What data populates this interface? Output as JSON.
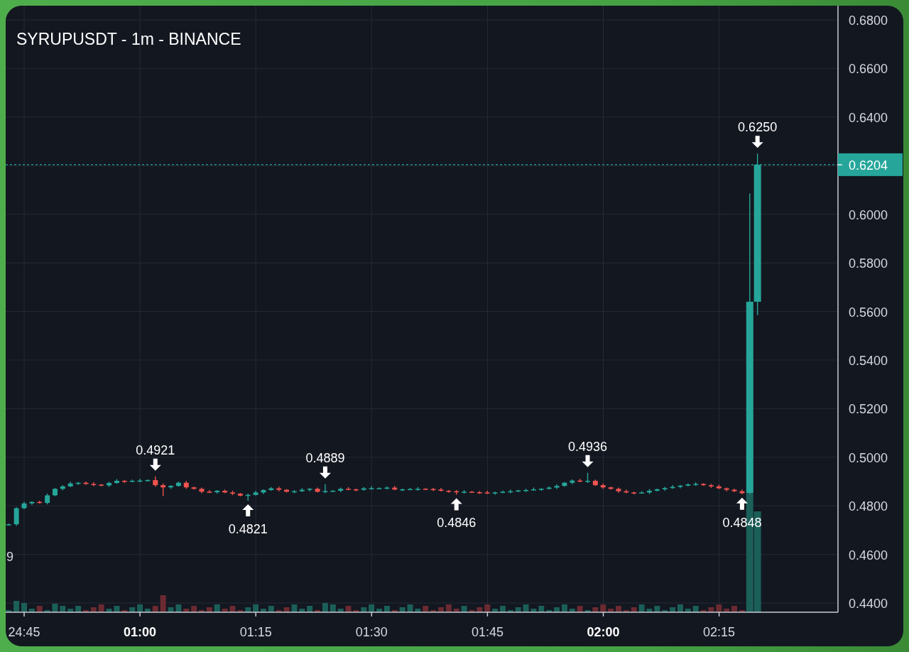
{
  "chart": {
    "title": "SYRUPUSDT - 1m - BINANCE",
    "price_axis": [
      "0.6800",
      "0.6600",
      "0.6400",
      "0.6000",
      "0.5800",
      "0.5600",
      "0.5400",
      "0.5200",
      "0.5000",
      "0.4800",
      "0.4600",
      "0.4400"
    ],
    "time_axis": [
      {
        "label": "24:45",
        "bold": false
      },
      {
        "label": "01:00",
        "bold": true
      },
      {
        "label": "01:15",
        "bold": false
      },
      {
        "label": "01:30",
        "bold": false
      },
      {
        "label": "01:45",
        "bold": false
      },
      {
        "label": "02:00",
        "bold": true
      },
      {
        "label": "02:15",
        "bold": false
      }
    ],
    "last_price": "0.6204",
    "markers": [
      {
        "kind": "high",
        "label": "0.4921"
      },
      {
        "kind": "low",
        "label": "0.4821"
      },
      {
        "kind": "high",
        "label": "0.4889"
      },
      {
        "kind": "low",
        "label": "0.4846"
      },
      {
        "kind": "high",
        "label": "0.4936"
      },
      {
        "kind": "low",
        "label": "0.4848"
      },
      {
        "kind": "high",
        "label": "0.6250"
      }
    ],
    "edge_label": "9"
  }
}
